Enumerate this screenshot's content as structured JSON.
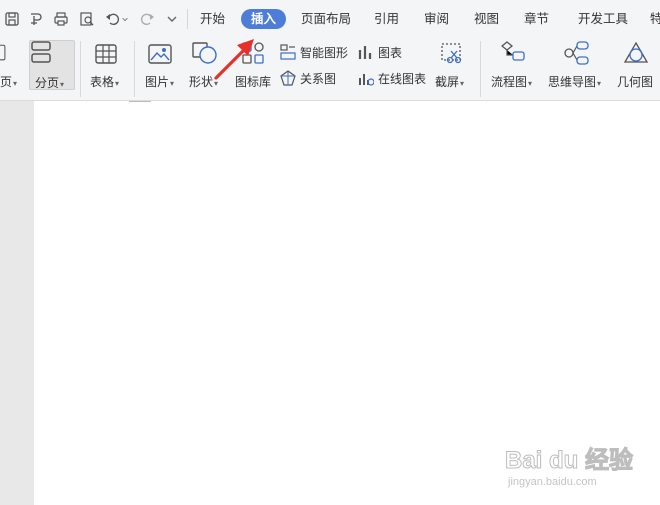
{
  "menu_tabs": [
    "开始",
    "插入",
    "页面布局",
    "引用",
    "审阅",
    "视图",
    "章节",
    "开发工具",
    "特"
  ],
  "active_tab": "插入",
  "ribbon": {
    "blank_page": "页",
    "page_break": "分页",
    "table": "表格",
    "picture": "图片",
    "shape": "形状",
    "icon_library": "图标库",
    "smart_graphic": "智能图形",
    "chart": "图表",
    "relation_chart": "关系图",
    "online_chart": "在线图表",
    "screenshot": "截屏",
    "flowchart": "流程图",
    "mind_map": "思维导图",
    "geometry": "几何图"
  },
  "watermark": {
    "main": "Bai du 经验",
    "sub": "jingyan.baidu.com"
  },
  "colors": {
    "active_tab_bg": "#4d7dd9",
    "arrow": "#e8302a",
    "icon_blue": "#3d6fc9",
    "ribbon_bg": "#f4f5f6"
  }
}
